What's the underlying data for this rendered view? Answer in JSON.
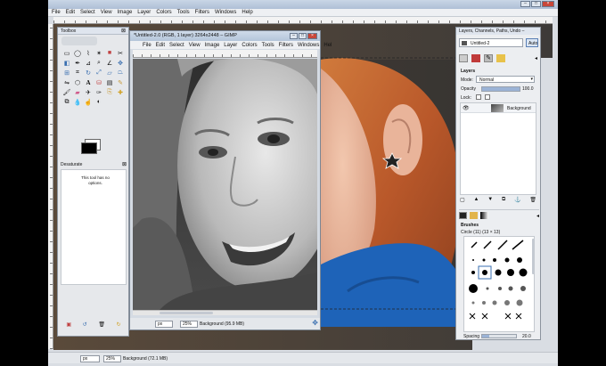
{
  "main_window": {
    "title": "",
    "menu": [
      "File",
      "Edit",
      "Select",
      "View",
      "Image",
      "Layer",
      "Colors",
      "Tools",
      "Filters",
      "Windows",
      "Help"
    ],
    "status": {
      "unit": "px",
      "zoom": "25%",
      "layer_info": "Background (72.1 MB)"
    }
  },
  "toolbox": {
    "title": "Toolbox",
    "tool_options_title": "Desaturate",
    "tool_options_text": "This tool has no options.",
    "tools": [
      "rect-select",
      "ellipse-select",
      "free-select",
      "fuzzy-select",
      "select-by-color",
      "scissors",
      "foreground-select",
      "paths",
      "color-picker",
      "zoom",
      "measure",
      "move",
      "align",
      "crop",
      "rotate",
      "scale",
      "shear",
      "perspective",
      "flip",
      "cage",
      "text",
      "bucket-fill",
      "blend",
      "pencil",
      "paintbrush",
      "eraser",
      "airbrush",
      "ink",
      "clone",
      "heal",
      "perspective-clone",
      "blur",
      "smudge",
      "dodge-burn"
    ]
  },
  "image_window": {
    "title": "*Untitled-2.0 (RGB, 1 layer) 3264x2448 – GIMP",
    "menu": [
      "File",
      "Edit",
      "Select",
      "View",
      "Image",
      "Layer",
      "Colors",
      "Tools",
      "Filters",
      "Windows",
      "Hel"
    ],
    "status": {
      "unit": "px",
      "zoom": "25%",
      "layer_info": "Background (95.9 MB)"
    }
  },
  "layers_dock": {
    "title": "Layers, Channels, Paths, Undo –",
    "image_selector": "Untitled-2",
    "auto_label": "Auto",
    "layers_section": "Layers",
    "mode_label": "Mode:",
    "mode_value": "Normal",
    "opacity_label": "Opacity",
    "opacity_value": "100.0",
    "lock_label": "Lock:",
    "layer_name": "Background",
    "brushes_section": "Brushes",
    "brush_name": "Circle (11) (13 × 13)",
    "spacing_label": "Spacing",
    "spacing_value": "20.0"
  },
  "colors": {
    "window_chrome": "#d9dde3",
    "title_gradient_top": "#c9d6e6",
    "close_button": "#c8473a",
    "highlight": "#3a6fb0"
  }
}
